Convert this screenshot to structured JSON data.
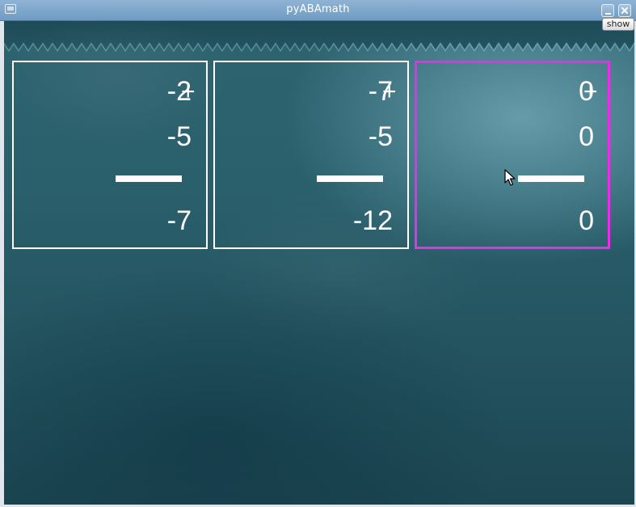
{
  "window": {
    "title": "pyABAmath"
  },
  "toolbar": {
    "show_label": "show"
  },
  "problems": [
    {
      "top": "-2",
      "operator": "+",
      "bottom": "-5",
      "answer": "-7",
      "selected": false
    },
    {
      "top": "-7",
      "operator": "+",
      "bottom": "-5",
      "answer": "-12",
      "selected": false
    },
    {
      "top": "0",
      "operator": "+",
      "bottom": "0",
      "answer": "0",
      "selected": true
    }
  ],
  "colors": {
    "selection_border": "#e82ee6",
    "card_border": "#ffffff",
    "chalkboard": "#2a5f6c"
  },
  "icons": {
    "app": "window-app-icon",
    "minimize": "minimize-icon",
    "close": "close-icon",
    "pointer": "mouse-pointer-icon"
  }
}
